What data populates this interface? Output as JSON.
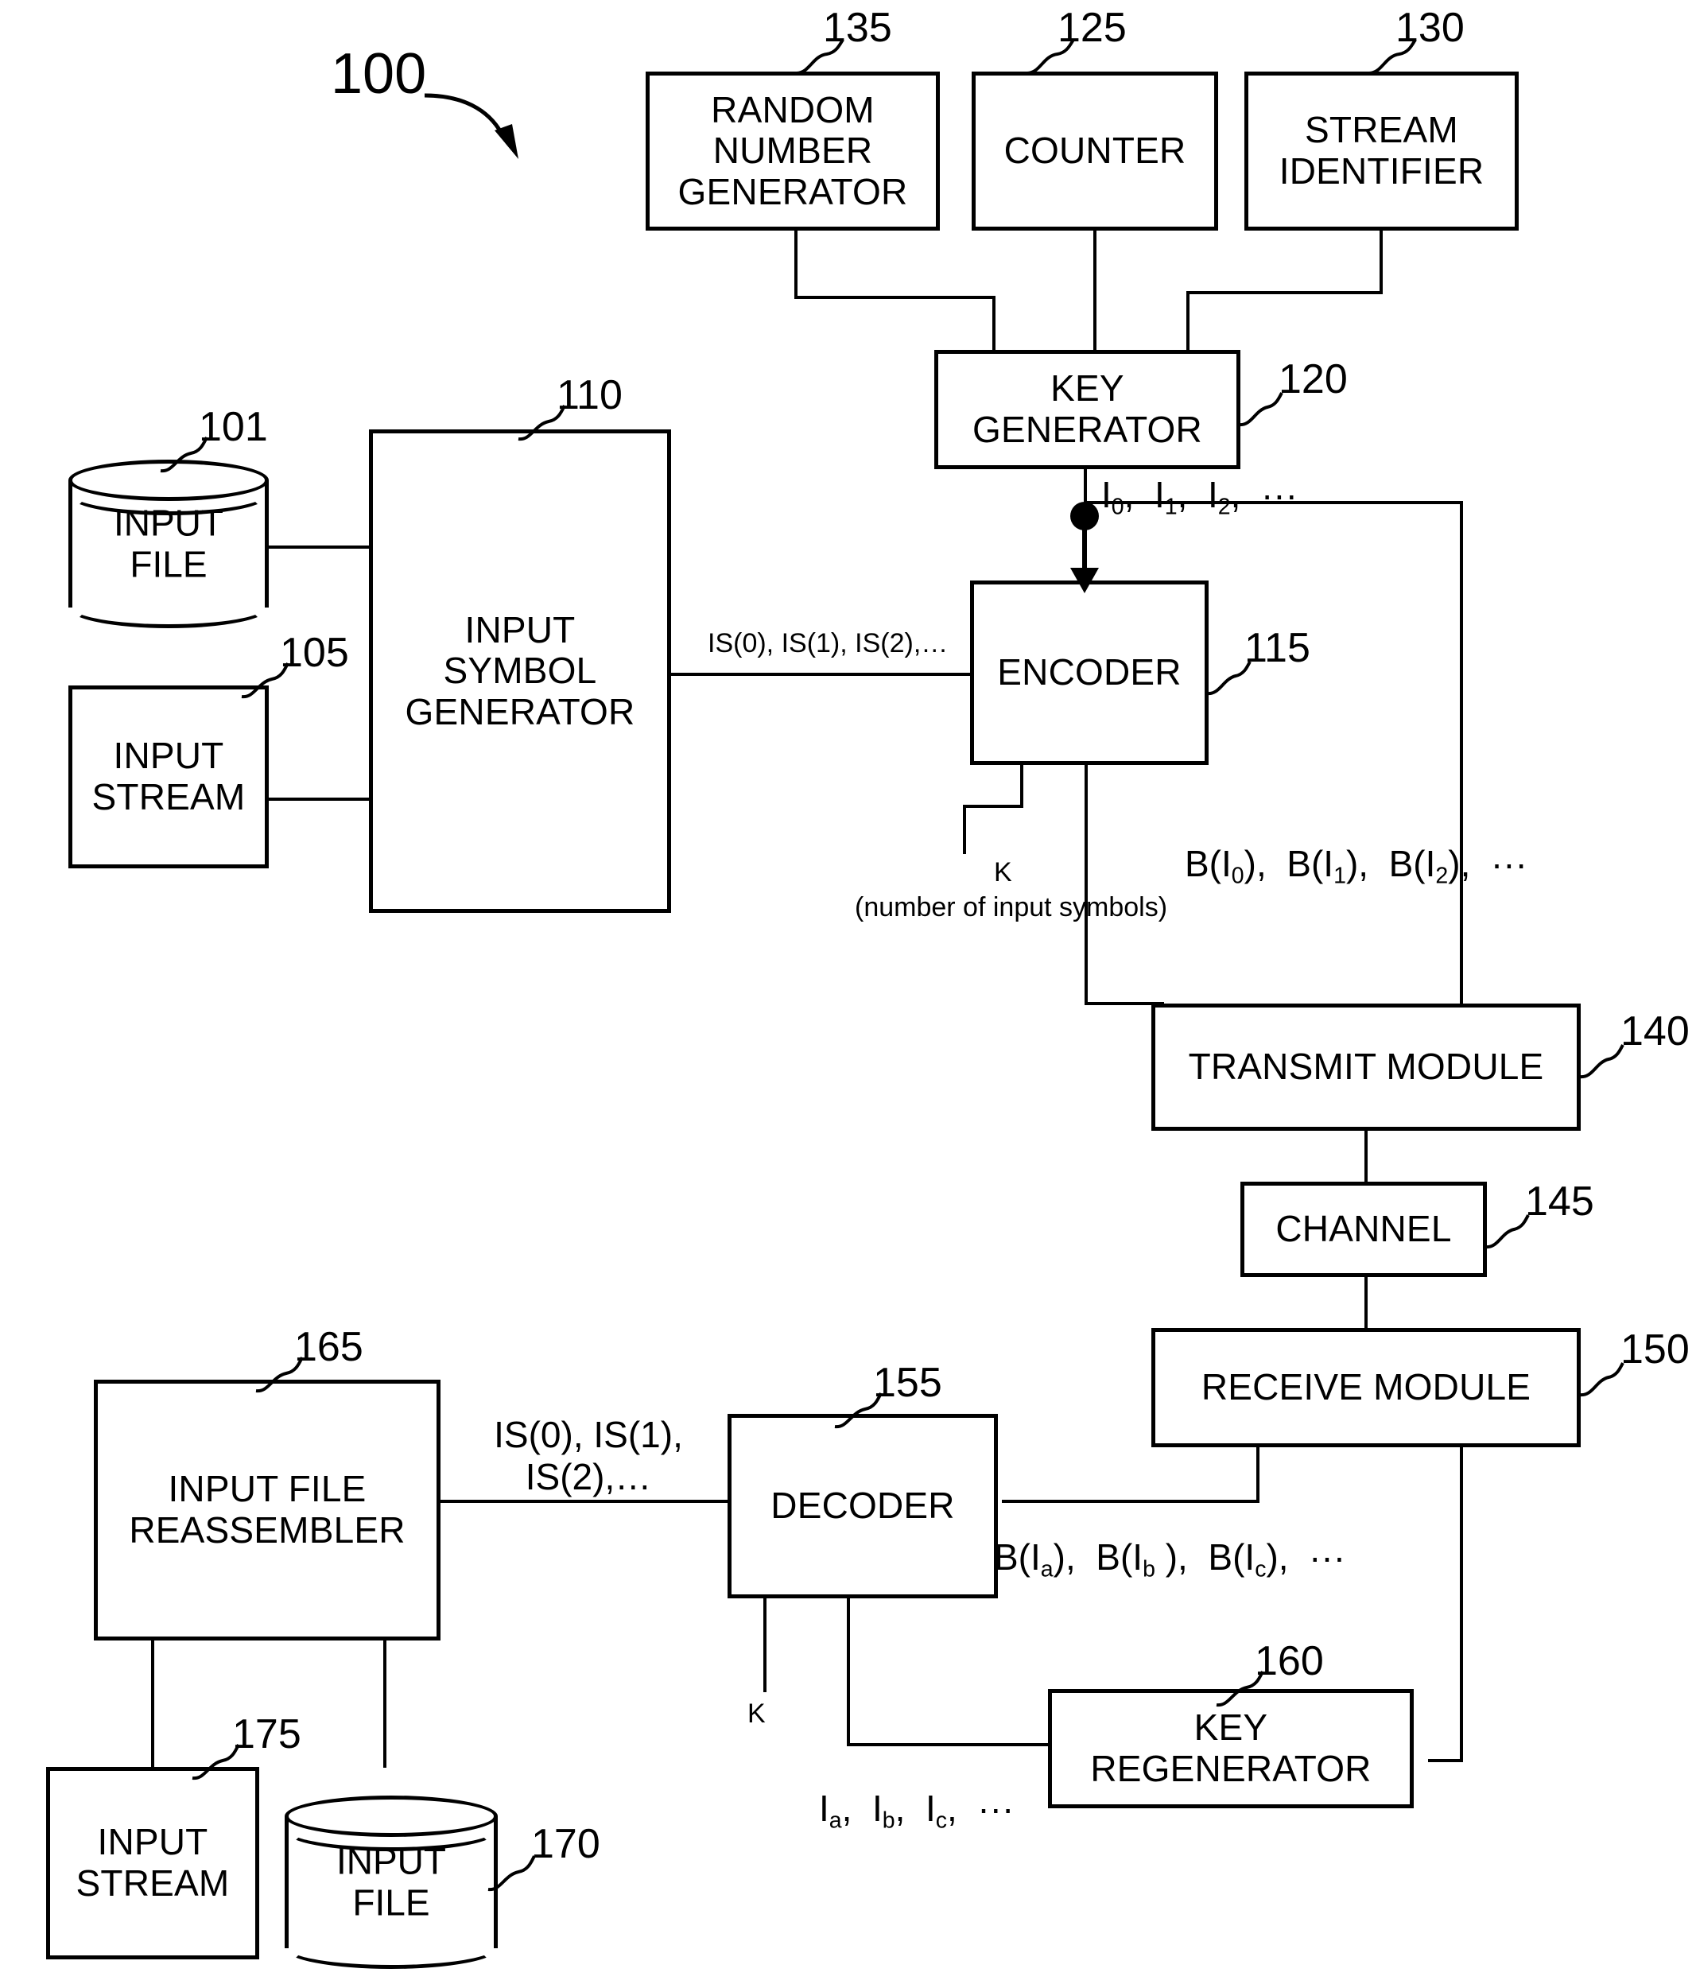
{
  "figure": {
    "number": "100",
    "type": "patent-block-diagram"
  },
  "blocks": {
    "random_number_generator": {
      "label": "RANDOM\nNUMBER\nGENERATOR",
      "ref": "135"
    },
    "counter": {
      "label": "COUNTER",
      "ref": "125"
    },
    "stream_identifier": {
      "label": "STREAM\nIDENTIFIER",
      "ref": "130"
    },
    "key_generator": {
      "label": "KEY\nGENERATOR",
      "ref": "120"
    },
    "input_file_top": {
      "label": "INPUT\nFILE",
      "ref": "101"
    },
    "input_stream_top": {
      "label": "INPUT\nSTREAM",
      "ref": "105"
    },
    "input_symbol_generator": {
      "label": "INPUT\nSYMBOL\nGENERATOR",
      "ref": "110"
    },
    "encoder": {
      "label": "ENCODER",
      "ref": "115"
    },
    "transmit_module": {
      "label": "TRANSMIT MODULE",
      "ref": "140"
    },
    "channel": {
      "label": "CHANNEL",
      "ref": "145"
    },
    "receive_module": {
      "label": "RECEIVE MODULE",
      "ref": "150"
    },
    "decoder": {
      "label": "DECODER",
      "ref": "155"
    },
    "key_regenerator": {
      "label": "KEY\nREGENERATOR",
      "ref": "160"
    },
    "input_file_reassembler": {
      "label": "INPUT FILE\nREASSEMBLER",
      "ref": "165"
    },
    "input_stream_bottom": {
      "label": "INPUT\nSTREAM",
      "ref": "175"
    },
    "input_file_bottom": {
      "label": "INPUT\nFILE",
      "ref": "170"
    }
  },
  "signal_labels": {
    "keys_out": "I0, I1, I2, …",
    "input_symbols": "IS(0), IS(1), IS(2),…",
    "k_symbol": "K",
    "k_description": "(number of input symbols)",
    "output_symbols": "B(I0), B(I1), B(I2), …",
    "received_symbols": "B(Ia), B(Ib), B(Ic), …",
    "decoded_symbols": "IS(0), IS(1),\nIS(2),…",
    "regen_keys": "Ia, Ib, Ic, …",
    "k_symbol_decoder": "K"
  }
}
